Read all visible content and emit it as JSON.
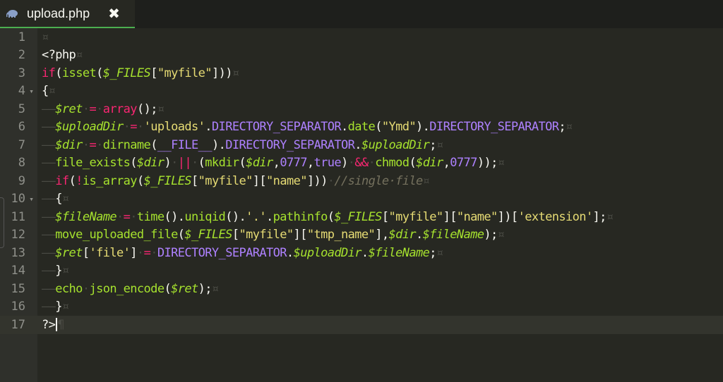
{
  "tab": {
    "title": "upload.php",
    "close_glyph": "✖",
    "icon": "php-elephant-icon"
  },
  "editor": {
    "invisible_space": "¤",
    "invisible_eol": "¶",
    "lines": [
      {
        "n": "1",
        "fold": ""
      },
      {
        "n": "2",
        "fold": ""
      },
      {
        "n": "3",
        "fold": ""
      },
      {
        "n": "4",
        "fold": "▾"
      },
      {
        "n": "5",
        "fold": ""
      },
      {
        "n": "6",
        "fold": ""
      },
      {
        "n": "7",
        "fold": ""
      },
      {
        "n": "8",
        "fold": ""
      },
      {
        "n": "9",
        "fold": ""
      },
      {
        "n": "10",
        "fold": "▾"
      },
      {
        "n": "11",
        "fold": ""
      },
      {
        "n": "12",
        "fold": ""
      },
      {
        "n": "13",
        "fold": ""
      },
      {
        "n": "14",
        "fold": ""
      },
      {
        "n": "15",
        "fold": ""
      },
      {
        "n": "16",
        "fold": ""
      },
      {
        "n": "17",
        "fold": ""
      }
    ],
    "code": [
      [
        [
          "ws",
          "¤"
        ]
      ],
      [
        [
          "",
          "<?php"
        ],
        [
          "ws",
          "¤"
        ]
      ],
      [
        [
          "kw",
          "if"
        ],
        [
          "",
          "("
        ],
        [
          "fn",
          "isset"
        ],
        [
          "",
          "("
        ],
        [
          "var",
          "$_FILES"
        ],
        [
          "",
          "["
        ],
        [
          "str",
          "\"myfile\""
        ],
        [
          "",
          "]))"
        ],
        [
          "ws",
          "¤"
        ]
      ],
      [
        [
          "",
          "{"
        ],
        [
          "ws",
          "¤"
        ]
      ],
      [
        [
          "ws",
          "——"
        ],
        [
          "var",
          "$ret"
        ],
        [
          "ws",
          "·"
        ],
        [
          "op",
          "="
        ],
        [
          "ws",
          "·"
        ],
        [
          "kw",
          "array"
        ],
        [
          "",
          "();"
        ],
        [
          "ws",
          "¤"
        ]
      ],
      [
        [
          "ws",
          "——"
        ],
        [
          "var",
          "$uploadDir"
        ],
        [
          "ws",
          "·"
        ],
        [
          "op",
          "="
        ],
        [
          "ws",
          "·"
        ],
        [
          "str",
          "'uploads'"
        ],
        [
          "",
          "."
        ],
        [
          "const",
          "DIRECTORY_SEPARATOR"
        ],
        [
          "",
          "."
        ],
        [
          "fn",
          "date"
        ],
        [
          "",
          "("
        ],
        [
          "str",
          "\"Ymd\""
        ],
        [
          "",
          ")."
        ],
        [
          "const",
          "DIRECTORY_SEPARATOR"
        ],
        [
          "",
          ";"
        ],
        [
          "ws",
          "¤"
        ]
      ],
      [
        [
          "ws",
          "——"
        ],
        [
          "var",
          "$dir"
        ],
        [
          "ws",
          "·"
        ],
        [
          "op",
          "="
        ],
        [
          "ws",
          "·"
        ],
        [
          "fn",
          "dirname"
        ],
        [
          "",
          "("
        ],
        [
          "const",
          "__FILE__"
        ],
        [
          "",
          ")."
        ],
        [
          "const",
          "DIRECTORY_SEPARATOR"
        ],
        [
          "",
          "."
        ],
        [
          "var",
          "$uploadDir"
        ],
        [
          "",
          ";"
        ],
        [
          "ws",
          "¤"
        ]
      ],
      [
        [
          "ws",
          "——"
        ],
        [
          "fn",
          "file_exists"
        ],
        [
          "",
          "("
        ],
        [
          "var",
          "$dir"
        ],
        [
          "",
          ")"
        ],
        [
          "ws",
          "·"
        ],
        [
          "op",
          "||"
        ],
        [
          "ws",
          "·"
        ],
        [
          "",
          "("
        ],
        [
          "fn",
          "mkdir"
        ],
        [
          "",
          "("
        ],
        [
          "var",
          "$dir"
        ],
        [
          "",
          ","
        ],
        [
          "const",
          "0777"
        ],
        [
          "",
          ","
        ],
        [
          "const",
          "true"
        ],
        [
          "",
          ")"
        ],
        [
          "ws",
          "·"
        ],
        [
          "op",
          "&&"
        ],
        [
          "ws",
          "·"
        ],
        [
          "fn",
          "chmod"
        ],
        [
          "",
          "("
        ],
        [
          "var",
          "$dir"
        ],
        [
          "",
          ","
        ],
        [
          "const",
          "0777"
        ],
        [
          "",
          "));"
        ],
        [
          "ws",
          "¤"
        ]
      ],
      [
        [
          "ws",
          "——"
        ],
        [
          "kw",
          "if"
        ],
        [
          "",
          "("
        ],
        [
          "op",
          "!"
        ],
        [
          "fn",
          "is_array"
        ],
        [
          "",
          "("
        ],
        [
          "var",
          "$_FILES"
        ],
        [
          "",
          "["
        ],
        [
          "str",
          "\"myfile\""
        ],
        [
          "",
          "]["
        ],
        [
          "str",
          "\"name\""
        ],
        [
          "",
          "]))"
        ],
        [
          "ws",
          "·"
        ],
        [
          "cm",
          "//single·file"
        ],
        [
          "ws",
          "¤"
        ]
      ],
      [
        [
          "ws",
          "——"
        ],
        [
          "",
          "{"
        ],
        [
          "ws",
          "¤"
        ]
      ],
      [
        [
          "ws",
          "——"
        ],
        [
          "var",
          "$fileName"
        ],
        [
          "ws",
          "·"
        ],
        [
          "op",
          "="
        ],
        [
          "ws",
          "·"
        ],
        [
          "fn",
          "time"
        ],
        [
          "",
          "()."
        ],
        [
          "fn",
          "uniqid"
        ],
        [
          "",
          "()."
        ],
        [
          "str",
          "'.'"
        ],
        [
          "",
          "."
        ],
        [
          "fn",
          "pathinfo"
        ],
        [
          "",
          "("
        ],
        [
          "var",
          "$_FILES"
        ],
        [
          "",
          "["
        ],
        [
          "str",
          "\"myfile\""
        ],
        [
          "",
          "]["
        ],
        [
          "str",
          "\"name\""
        ],
        [
          "",
          "])["
        ],
        [
          "str",
          "'extension'"
        ],
        [
          "",
          "];"
        ],
        [
          "ws",
          "¤"
        ]
      ],
      [
        [
          "ws",
          "——"
        ],
        [
          "fn",
          "move_uploaded_file"
        ],
        [
          "",
          "("
        ],
        [
          "var",
          "$_FILES"
        ],
        [
          "",
          "["
        ],
        [
          "str",
          "\"myfile\""
        ],
        [
          "",
          "]["
        ],
        [
          "str",
          "\"tmp_name\""
        ],
        [
          "",
          "],"
        ],
        [
          "var",
          "$dir"
        ],
        [
          "",
          "."
        ],
        [
          "var",
          "$fileName"
        ],
        [
          "",
          ");"
        ],
        [
          "ws",
          "¤"
        ]
      ],
      [
        [
          "ws",
          "——"
        ],
        [
          "var",
          "$ret"
        ],
        [
          "",
          "["
        ],
        [
          "str",
          "'file'"
        ],
        [
          "",
          "]"
        ],
        [
          "ws",
          "·"
        ],
        [
          "op",
          "="
        ],
        [
          "ws",
          "·"
        ],
        [
          "const",
          "DIRECTORY_SEPARATOR"
        ],
        [
          "",
          "."
        ],
        [
          "var",
          "$uploadDir"
        ],
        [
          "",
          "."
        ],
        [
          "var",
          "$fileName"
        ],
        [
          "",
          ";"
        ],
        [
          "ws",
          "¤"
        ]
      ],
      [
        [
          "ws",
          "——"
        ],
        [
          "",
          "}"
        ],
        [
          "ws",
          "¤"
        ]
      ],
      [
        [
          "ws",
          "——"
        ],
        [
          "fn",
          "echo"
        ],
        [
          "ws",
          "·"
        ],
        [
          "fn",
          "json_encode"
        ],
        [
          "",
          "("
        ],
        [
          "var",
          "$ret"
        ],
        [
          "",
          ");"
        ],
        [
          "ws",
          "¤"
        ]
      ],
      [
        [
          "ws",
          "——"
        ],
        [
          "",
          "}"
        ],
        [
          "ws",
          "¤"
        ]
      ],
      [
        [
          "",
          "?>"
        ]
      ]
    ],
    "active_line": 17
  },
  "colors": {
    "background": "#272822",
    "gutter": "#2f302b",
    "tab_underline": "#4caf50",
    "keyword": "#f92672",
    "function": "#a6e22e",
    "string": "#e6db74",
    "constant": "#ae81ff",
    "comment": "#75715e"
  }
}
